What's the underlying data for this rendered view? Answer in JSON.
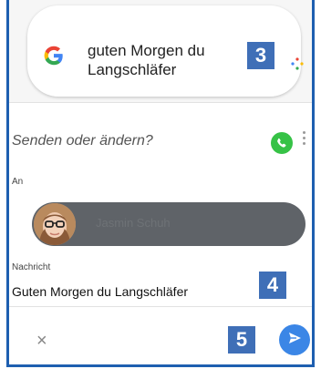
{
  "search": {
    "query": "guten Morgen du Langschläfer",
    "logo_icon": "google-g-icon",
    "assistant_icon": "google-assistant-dots-icon"
  },
  "badges": {
    "b3": "3",
    "b4": "4",
    "b5": "5"
  },
  "compose": {
    "prompt": "Senden oder ändern?",
    "app_icon": "whatsapp-icon",
    "to_label": "An",
    "recipient_name": "Jasmin Schuh",
    "message_label": "Nachricht",
    "message_text": "Guten Morgen du Langschläfer",
    "close_icon": "×",
    "send_icon": "send-arrow-icon"
  },
  "colors": {
    "badge": "#3f6fb7",
    "frame": "#1e5fb0",
    "send": "#3b86e6",
    "chip": "#5f6368",
    "whatsapp": "#36c246"
  }
}
